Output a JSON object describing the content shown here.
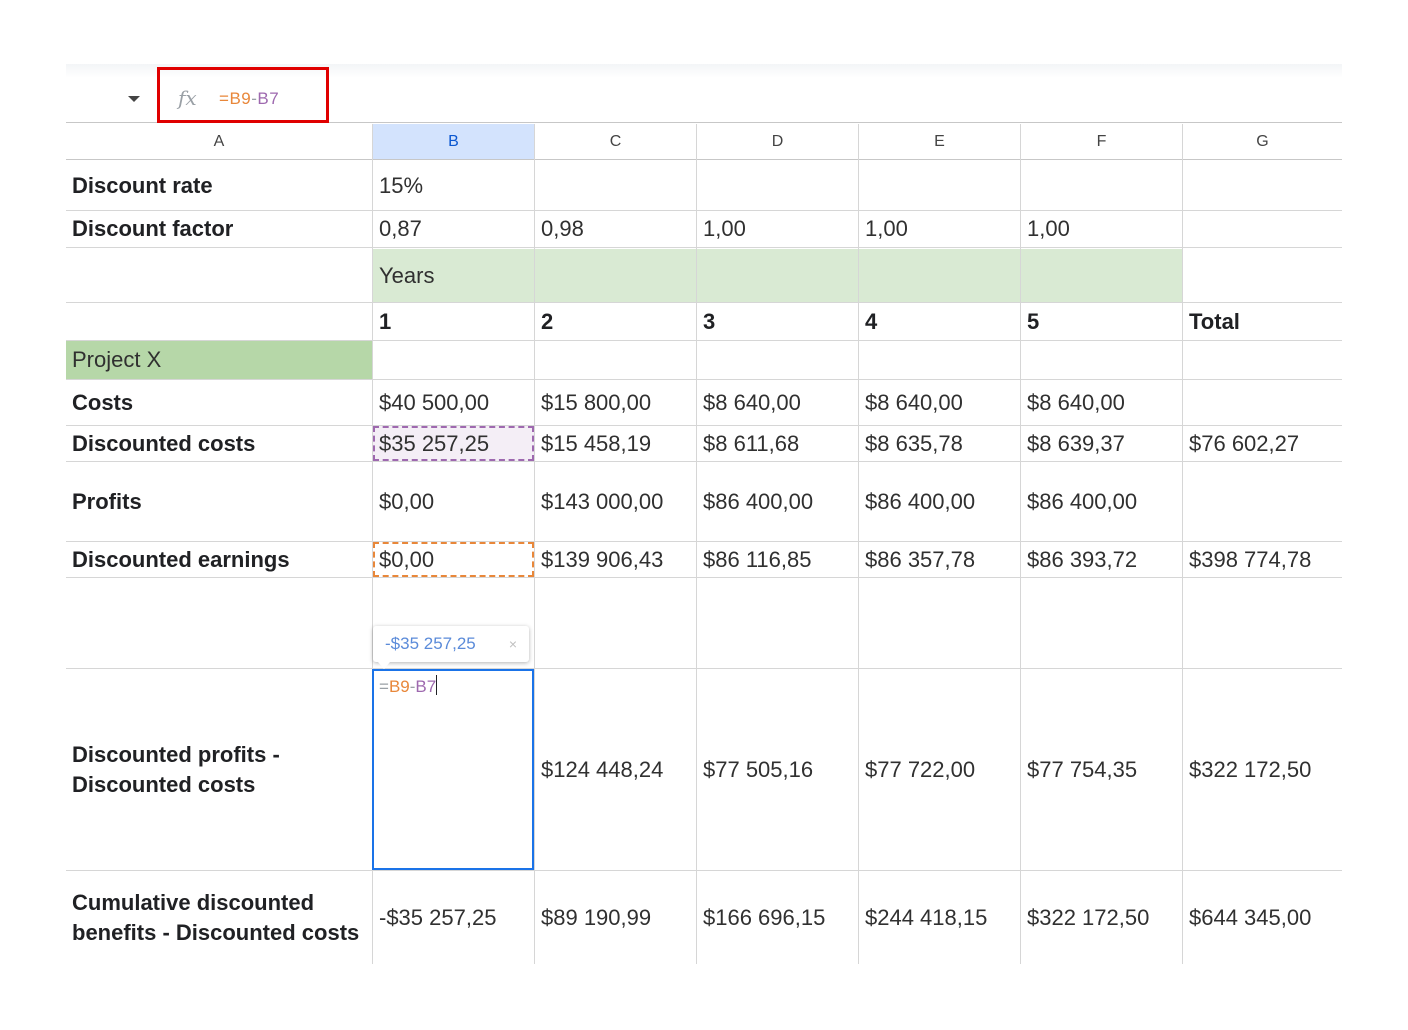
{
  "formula_bar": {
    "fx_label": "fx",
    "formula_eq": "=",
    "formula_ref1": "B9",
    "formula_minus": "-",
    "formula_ref2": "B7"
  },
  "columns": [
    "A",
    "B",
    "C",
    "D",
    "E",
    "F",
    "G"
  ],
  "selected_column": "B",
  "rows": {
    "discount_rate": {
      "label": "Discount rate",
      "b": "15%"
    },
    "discount_factor": {
      "label": "Discount factor",
      "values": [
        "0,87",
        "0,98",
        "1,00",
        "1,00",
        "1,00"
      ]
    },
    "years": {
      "label": "Years"
    },
    "year_numbers": {
      "values": [
        "1",
        "2",
        "3",
        "4",
        "5"
      ],
      "total": "Total"
    },
    "project": {
      "label": "Project X"
    },
    "costs": {
      "label": "Costs",
      "values": [
        "$40 500,00",
        "$15 800,00",
        "$8 640,00",
        "$8 640,00",
        "$8 640,00"
      ]
    },
    "discounted_costs": {
      "label": "Discounted costs",
      "values": [
        "$35 257,25",
        "$15 458,19",
        "$8 611,68",
        "$8 635,78",
        "$8 639,37"
      ],
      "total": "$76 602,27"
    },
    "profits": {
      "label": "Profits",
      "values": [
        "$0,00",
        "$143 000,00",
        "$86 400,00",
        "$86 400,00",
        "$86 400,00"
      ]
    },
    "discounted_earnings": {
      "label": "Discounted earnings",
      "values": [
        "$0,00",
        "$139 906,43",
        "$86 116,85",
        "$86 357,78",
        "$86 393,72"
      ],
      "total": "$398 774,78"
    },
    "disc_profits_minus_costs": {
      "label": "Discounted profits - Discounted costs",
      "values": [
        "$124 448,24",
        "$77 505,16",
        "$77 722,00",
        "$77 754,35"
      ],
      "total": "$322 172,50"
    },
    "cumulative": {
      "label": "Cumulative discounted benefits - Discounted costs",
      "values": [
        "-$35 257,25",
        "$89 190,99",
        "$166 696,15",
        "$244 418,15",
        "$322 172,50"
      ],
      "total": "$644 345,00"
    }
  },
  "editor": {
    "preview": "-$35 257,25",
    "close": "×",
    "eq": "=",
    "ref1": "B9",
    "minus": "-",
    "ref2": "B7"
  }
}
